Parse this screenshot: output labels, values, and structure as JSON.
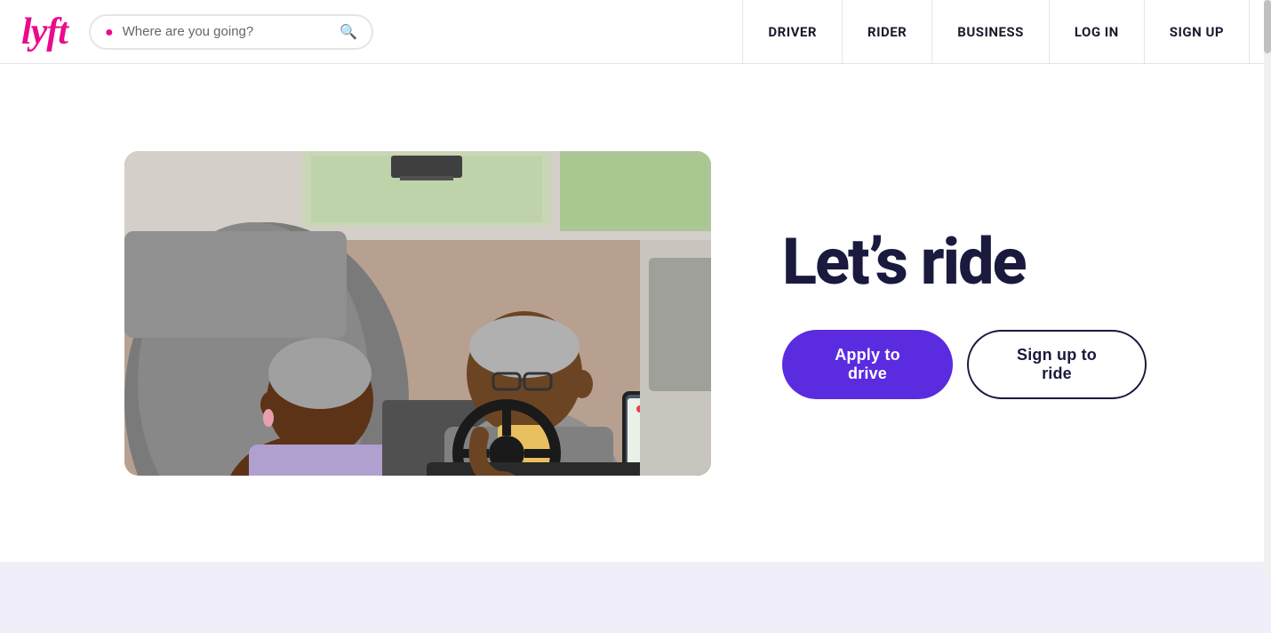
{
  "header": {
    "logo": "lyft",
    "search": {
      "placeholder": "Where are you going?",
      "value": ""
    },
    "nav": {
      "items": [
        {
          "id": "driver",
          "label": "DRIVER"
        },
        {
          "id": "rider",
          "label": "RIDER"
        },
        {
          "id": "business",
          "label": "BUSINESS"
        },
        {
          "id": "login",
          "label": "LOG IN"
        },
        {
          "id": "signup",
          "label": "SIGN UP"
        }
      ]
    }
  },
  "hero": {
    "heading": "Let’s ride",
    "buttons": {
      "apply": "Apply to drive",
      "signup": "Sign up to ride"
    }
  },
  "colors": {
    "lyft_pink": "#ea0b8c",
    "nav_dark": "#1a1a2e",
    "hero_heading": "#1a1a3e",
    "apply_bg": "#5b2be0",
    "apply_text": "#ffffff",
    "signup_bg": "#ffffff",
    "signup_border": "#1a1a3e",
    "footer_bg": "#f0eef8"
  }
}
